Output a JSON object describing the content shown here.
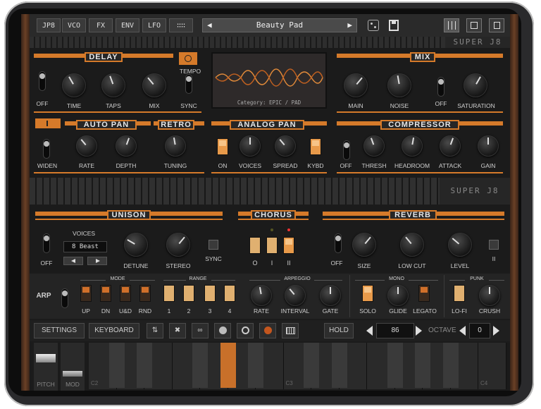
{
  "topbar": {
    "tabs": [
      "JP8",
      "VCO",
      "FX",
      "ENV",
      "LFO",
      "∷∷"
    ],
    "preset_name": "Beauty Pad",
    "prev_arrow": "◀",
    "next_arrow": "▶"
  },
  "brand": "SUPER J8",
  "delay": {
    "title": "DELAY",
    "off": "OFF",
    "time": "TIME",
    "taps": "TAPS",
    "mix": "MIX",
    "tempo": "TEMPO",
    "sync": "SYNC"
  },
  "display": {
    "category": "Category: EPIC / PAD"
  },
  "mix": {
    "title": "MIX",
    "main": "MAIN",
    "noise": "NOISE",
    "off": "OFF",
    "saturation": "SATURATION"
  },
  "autopan": {
    "title": "AUTO PAN",
    "widen": "WIDEN",
    "rate": "RATE",
    "depth": "DEPTH"
  },
  "retro": {
    "title": "RETRO",
    "tuning": "TUNING"
  },
  "analogpan": {
    "title": "ANALOG PAN",
    "on": "ON",
    "voices": "VOICES",
    "spread": "SPREAD",
    "kybd": "KYBD"
  },
  "compressor": {
    "title": "COMPRESSOR",
    "off": "OFF",
    "thresh": "THRESH",
    "headroom": "HEADROOM",
    "attack": "ATTACK",
    "gain": "GAIN"
  },
  "unison": {
    "title": "UNISON",
    "voices_label": "VOICES",
    "voices_value": "8 Beast",
    "off": "OFF",
    "detune": "DETUNE",
    "stereo": "STEREO",
    "sync": "SYNC"
  },
  "chorus": {
    "title": "CHORUS",
    "o": "O",
    "i": "I",
    "ii": "II"
  },
  "reverb": {
    "title": "REVERB",
    "off": "OFF",
    "size": "SIZE",
    "lowcut": "LOW CUT",
    "level": "LEVEL",
    "ii": "II"
  },
  "arp": {
    "label": "ARP",
    "mode_title": "MODE",
    "range_title": "RANGE",
    "arpeggio_title": "ARPEGGIO",
    "mono_title": "MONO",
    "punk_title": "PUNK",
    "modes": [
      "UP",
      "DN",
      "U&D",
      "RND"
    ],
    "ranges": [
      "1",
      "2",
      "3",
      "4"
    ],
    "rate": "RATE",
    "interval": "INTERVAL",
    "gate": "GATE",
    "solo": "SOLO",
    "glide": "GLIDE",
    "legato": "LEGATO",
    "lofi": "LO-FI",
    "crush": "CRUSH"
  },
  "bottombar": {
    "settings": "SETTINGS",
    "keyboard": "KEYBOARD",
    "hold": "HOLD",
    "tempo_value": "86",
    "octave_label": "OCTAVE",
    "octave_value": "0"
  },
  "keyboard": {
    "pitch": "PITCH",
    "mod": "MOD",
    "c2": "C2",
    "c3": "C3",
    "c4": "C4"
  },
  "colors": {
    "accent": "#d57a2a",
    "background": "#1b1b1b"
  }
}
